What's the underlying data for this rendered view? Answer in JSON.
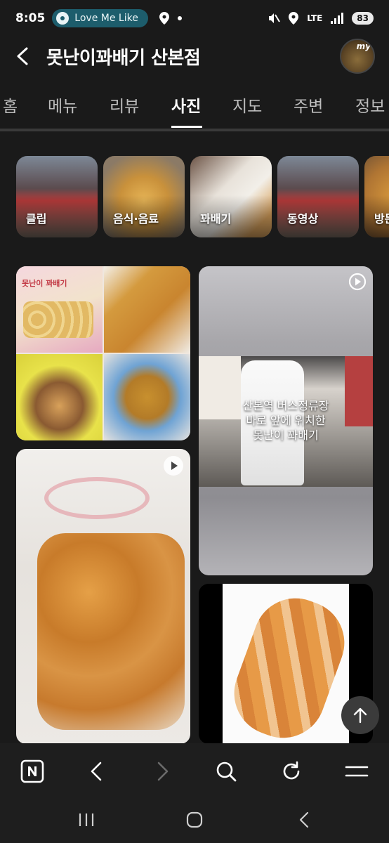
{
  "status_bar": {
    "time": "8:05",
    "media_title": "Love Me Like",
    "network": "LTE",
    "battery": "83",
    "icons": [
      "music-disc-icon",
      "location-pin-icon",
      "mute-icon",
      "signal-icon"
    ]
  },
  "header": {
    "title": "못난이꽈배기 산본점",
    "avatar_badge": "my"
  },
  "tabs": [
    {
      "label": "홈",
      "active": false
    },
    {
      "label": "메뉴",
      "active": false
    },
    {
      "label": "리뷰",
      "active": false
    },
    {
      "label": "사진",
      "active": true
    },
    {
      "label": "지도",
      "active": false
    },
    {
      "label": "주변",
      "active": false
    },
    {
      "label": "정보",
      "active": false
    }
  ],
  "categories": [
    {
      "label": "클립"
    },
    {
      "label": "음식·음료"
    },
    {
      "label": "꽈배기"
    },
    {
      "label": "동영상"
    },
    {
      "label": "방문"
    }
  ],
  "photos": {
    "video_caption_lines": [
      "산본역 버스정류장",
      "바로 앞에 위치한",
      "못난이 꽈배기"
    ],
    "collage_banner": "못난이 꽈배기"
  },
  "bottom_toolbar": {
    "icons": [
      "naver-icon",
      "back-arrow-icon",
      "forward-arrow-icon",
      "search-icon",
      "refresh-icon",
      "menu-icon"
    ]
  },
  "system_nav": {
    "icons": [
      "recent-apps-icon",
      "home-icon",
      "system-back-icon"
    ]
  },
  "colors": {
    "background": "#1a1a1a",
    "music_pill": "#1d5d6c",
    "active_tab": "#ffffff",
    "inactive_tab": "#bdbdbd"
  }
}
